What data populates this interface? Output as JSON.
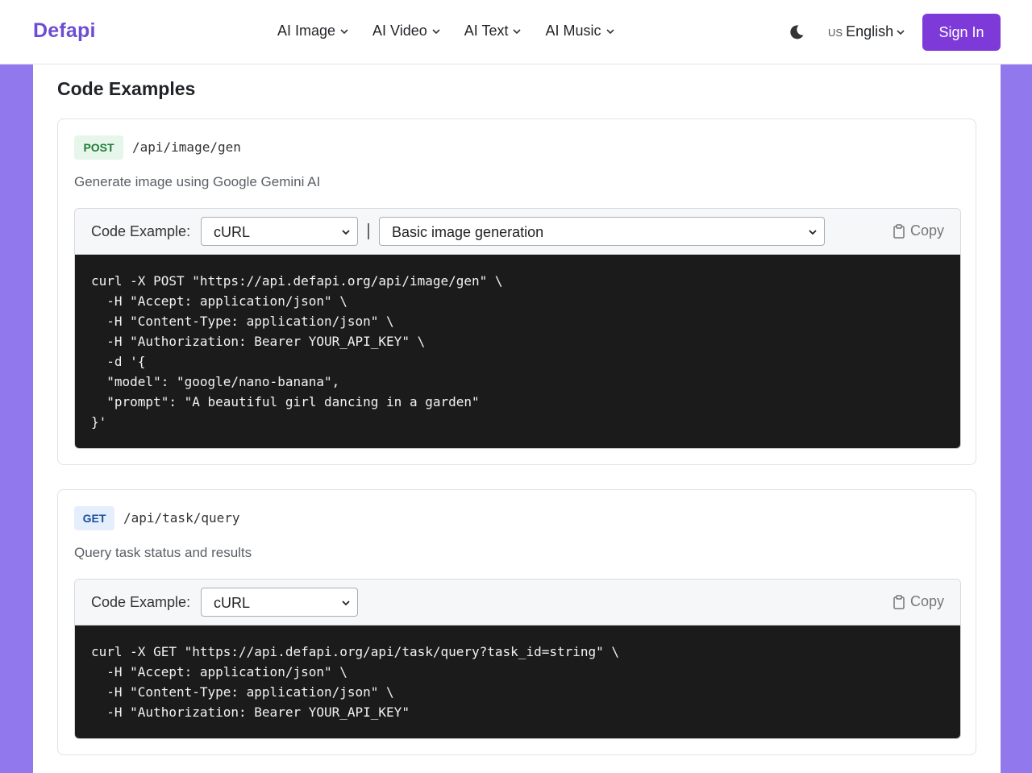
{
  "header": {
    "logo": "Defapi",
    "nav": [
      {
        "label": "AI Image"
      },
      {
        "label": "AI Video"
      },
      {
        "label": "AI Text"
      },
      {
        "label": "AI Music"
      }
    ],
    "language_flag": "US",
    "language": "English",
    "sign_in": "Sign In"
  },
  "section": {
    "title": "Code Examples"
  },
  "examples": [
    {
      "method": "POST",
      "endpoint": "/api/image/gen",
      "description": "Generate image using Google Gemini AI",
      "code_label": "Code Example:",
      "language": "cURL",
      "variant": "Basic image generation",
      "copy_label": "Copy",
      "code": "curl -X POST \"https://api.defapi.org/api/image/gen\" \\\n  -H \"Accept: application/json\" \\\n  -H \"Content-Type: application/json\" \\\n  -H \"Authorization: Bearer YOUR_API_KEY\" \\\n  -d '{\n  \"model\": \"google/nano-banana\",\n  \"prompt\": \"A beautiful girl dancing in a garden\"\n}'"
    },
    {
      "method": "GET",
      "endpoint": "/api/task/query",
      "description": "Query task status and results",
      "code_label": "Code Example:",
      "language": "cURL",
      "copy_label": "Copy",
      "code": "curl -X GET \"https://api.defapi.org/api/task/query?task_id=string\" \\\n  -H \"Accept: application/json\" \\\n  -H \"Content-Type: application/json\" \\\n  -H \"Authorization: Bearer YOUR_API_KEY\""
    }
  ],
  "colors": {
    "brand": "#6d4bd3",
    "sign_in_bg": "#7e3ad9",
    "page_bg": "#9178ec",
    "code_bg": "#1b1b1b"
  }
}
